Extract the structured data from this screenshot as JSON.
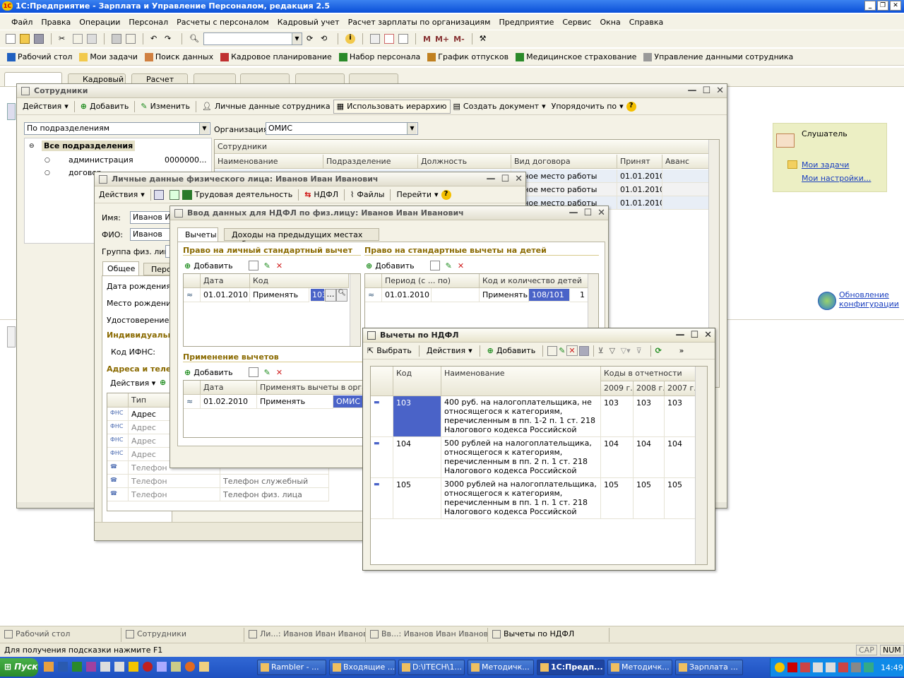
{
  "app": {
    "title": "1С:Предприятие - Зарплата и Управление Персоналом, редакция 2.5"
  },
  "menu": [
    "Файл",
    "Правка",
    "Операции",
    "Персонал",
    "Расчеты с персоналом",
    "Кадровый учет",
    "Расчет зарплаты по организациям",
    "Предприятие",
    "Сервис",
    "Окна",
    "Справка"
  ],
  "panel": {
    "items": [
      "Рабочий стол",
      "Мои задачи",
      "Поиск данных",
      "Кадровое планирование",
      "Набор персонала",
      "График отпусков",
      "Медицинское страхование",
      "Управление данными сотрудника"
    ]
  },
  "tabs": [
    "Кадровый",
    "Расчет"
  ],
  "employees": {
    "title": "Сотрудники",
    "toolbar": {
      "actions": "Действия",
      "add": "Добавить",
      "edit": "Изменить",
      "personal": "Личные данные сотрудника",
      "hierarchy": "Использовать иерархию",
      "create_doc": "Создать документ",
      "order": "Упорядочить по"
    },
    "view_select": "По подразделениям",
    "org_label": "Организация:",
    "org_value": "ОМИС",
    "tree": {
      "root": "Все подразделения",
      "items": [
        "администрация",
        "договор"
      ],
      "item_value": "0000000..."
    },
    "grid_title": "Сотрудники",
    "columns": [
      "Наименование",
      "Подразделение",
      "Должность",
      "Вид договора",
      "Принят",
      "Аванс"
    ],
    "rows": [
      {
        "contract": "овное место работы",
        "date": "01.01.2010"
      },
      {
        "contract": "овное место работы",
        "date": "01.01.2010"
      },
      {
        "contract": "овное место работы",
        "date": "01.01.2010"
      }
    ]
  },
  "personal": {
    "title": "Личные данные физического лица: Иванов Иван Иванович",
    "toolbar": {
      "actions": "Действия",
      "work": "Трудовая деятельность",
      "ndfl": "НДФЛ",
      "files": "Файлы",
      "goto": "Перейти"
    },
    "name_label": "Имя:",
    "name_value": "Иванов Ив",
    "fio_label": "ФИО:",
    "fio_value": "Иванов",
    "group_label": "Группа физ. лиц:",
    "tabs": [
      "Общее",
      "Перс"
    ],
    "birth_date": "Дата рождения:",
    "birth_place": "Место рождения:",
    "id_doc": "Удостоверение:",
    "individual": "Индивидуальн",
    "ifns": "Код ИФНС:",
    "addresses": "Адреса и теле",
    "actions": "Действия",
    "type_col": "Тип",
    "contact_rows": [
      {
        "type": "Адрес",
        "kind": ""
      },
      {
        "type": "Адрес",
        "kind": ""
      },
      {
        "type": "Адрес",
        "kind": ""
      },
      {
        "type": "Адрес",
        "kind": ""
      },
      {
        "type": "Телефон",
        "kind": ""
      },
      {
        "type": "Телефон",
        "kind": "Телефон служебный"
      },
      {
        "type": "Телефон",
        "kind": "Телефон физ. лица"
      }
    ]
  },
  "ndfl": {
    "title": "Ввод данных для НДФЛ по физ.лицу: Иванов Иван Иванович",
    "tabs": [
      "Вычеты",
      "Доходы на предыдущих местах работы"
    ],
    "personal_section": "Право на личный стандартный вычет",
    "children_section": "Право на стандартные вычеты на детей",
    "apply_section": "Применение вычетов",
    "add": "Добавить",
    "personal_cols": [
      "Дата",
      "Код"
    ],
    "personal_row": {
      "date": "01.01.2010",
      "apply": "Применять",
      "code": "103"
    },
    "children_cols": [
      "Период (с ... по)",
      "Код и количество детей"
    ],
    "children_row": {
      "date": "01.01.2010",
      "apply": "Применять",
      "code": "108/101",
      "count": "1"
    },
    "apply_cols": [
      "Дата",
      "Применять вычеты в органи"
    ],
    "apply_row": {
      "date": "01.02.2010",
      "apply": "Применять",
      "org": "ОМИС"
    }
  },
  "deductions": {
    "title": "Вычеты по НДФЛ",
    "toolbar": {
      "select": "Выбрать",
      "actions": "Действия",
      "add": "Добавить"
    },
    "columns": {
      "code": "Код",
      "name": "Наименование",
      "report": "Коды в отчетности",
      "years": [
        "2009 г.",
        "2008 г.",
        "2007 г."
      ]
    },
    "rows": [
      {
        "code": "103",
        "name": [
          "400 руб. на налогоплательщика, не",
          "относящегося к категориям,",
          "перечисленным в пп. 1-2 п. 1 ст. 218",
          "Налогового кодекса Российской"
        ],
        "y2009": "103",
        "y2008": "103",
        "y2007": "103"
      },
      {
        "code": "104",
        "name": [
          "500 рублей на налогоплательщика,",
          "относящегося к категориям,",
          "перечисленным в пп. 2 п. 1 ст. 218",
          "Налогового кодекса Российской"
        ],
        "y2009": "104",
        "y2008": "104",
        "y2007": "104"
      },
      {
        "code": "105",
        "name": [
          "3000 рублей на налогоплательщика,",
          "относящегося к категориям,",
          "перечисленным в пп. 1 п. 1 ст. 218",
          "Налогового кодекса Российской"
        ],
        "y2009": "105",
        "y2008": "105",
        "y2007": "105"
      }
    ]
  },
  "sidepanel": {
    "user": "Слушатель",
    "tasks": "Мои задачи",
    "settings": "Мои настройки...",
    "update": [
      "Обновление",
      "конфигурации"
    ]
  },
  "windowbar": [
    "Рабочий стол",
    "Сотрудники",
    "Ли...: Иванов Иван Иванович",
    "Вв...: Иванов Иван Иванович",
    "Вычеты по НДФЛ"
  ],
  "status": {
    "hint": "Для получения подсказки нажмите F1",
    "cap": "CAP",
    "num": "NUM"
  },
  "taskbar": {
    "start": "Пуск",
    "items": [
      "Rambler - ...",
      "Входящие ...",
      "D:\\ITECH\\1...",
      "Методичк...",
      "1С:Предп...",
      "Методичк...",
      "Зарплата ..."
    ],
    "clock": "14:49"
  },
  "colors": {
    "titlebar": "#0a54e0",
    "selection": "#4a63c8",
    "section": "#8a6a00"
  }
}
